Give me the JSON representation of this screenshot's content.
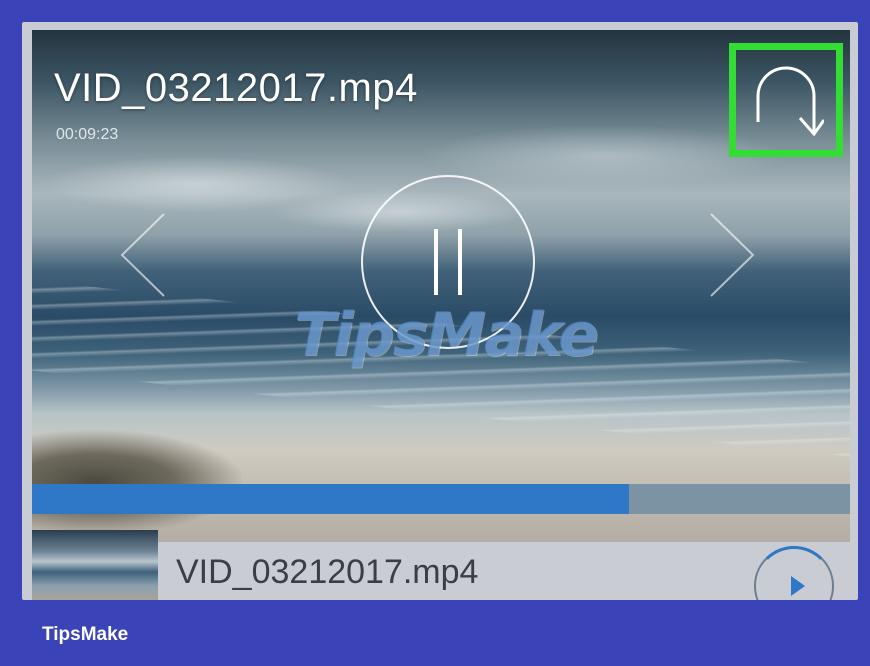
{
  "player": {
    "video_title": "VID_03212017.mp4",
    "duration": "00:09:23",
    "progress_fraction": 0.73,
    "watermark": "TipsMake"
  },
  "playlist": {
    "items": [
      {
        "title": "VID_03212017.mp4"
      }
    ]
  },
  "footer": {
    "brand": "TipsMake"
  },
  "colors": {
    "background": "#3a44b8",
    "highlight": "#33dd33",
    "progress": "#2f78c8"
  },
  "icons": [
    "rotate-icon",
    "pause-icon",
    "prev-icon",
    "next-icon",
    "play-icon"
  ]
}
